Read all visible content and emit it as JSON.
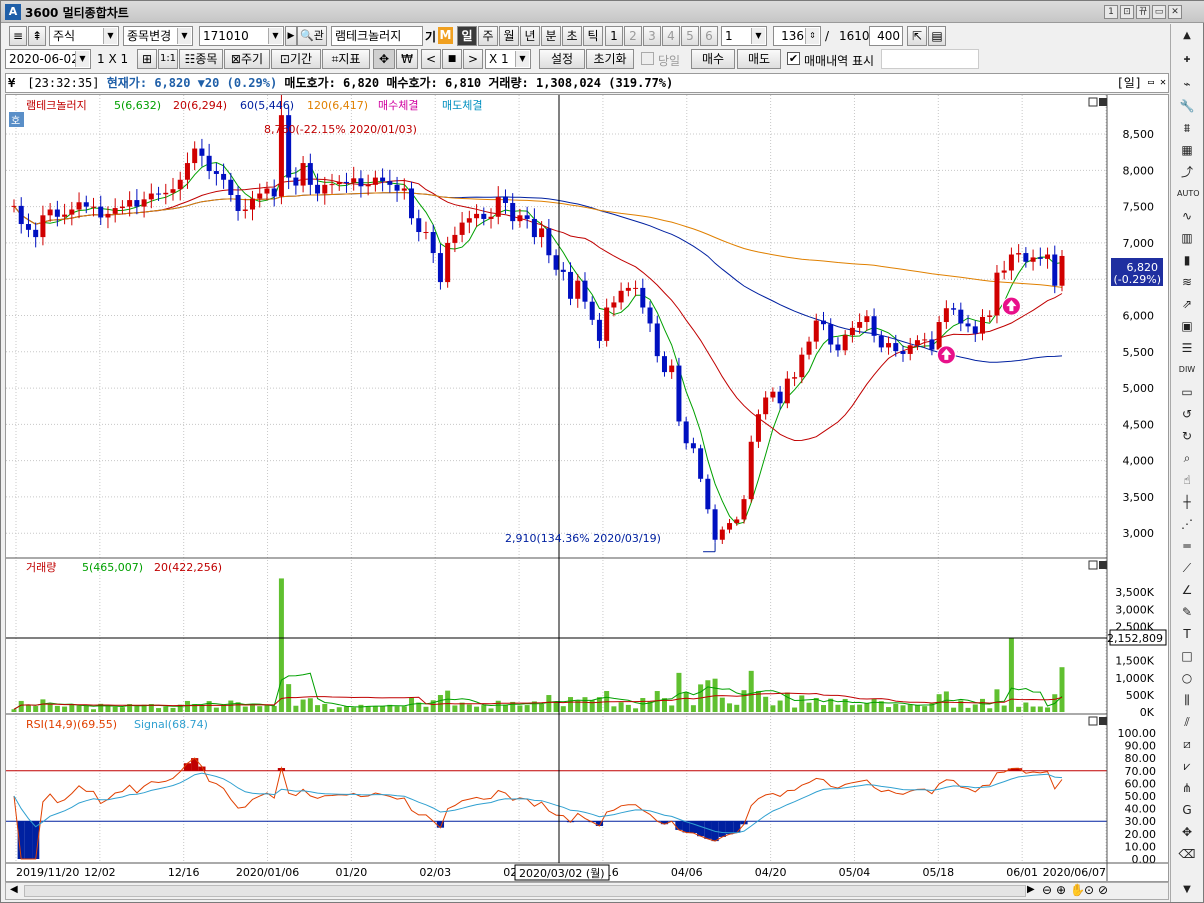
{
  "window": {
    "title": "3600 멀티종합차트",
    "controls": [
      "1",
      "⊡",
      "뀨",
      "▭",
      "✕"
    ]
  },
  "toolbar1": {
    "type": "주식",
    "stock_action": "종목변경",
    "code": "171010",
    "search_icon_label": "관",
    "name": "램테크놀러지",
    "marks": [
      "기",
      "M"
    ],
    "periods": [
      "일",
      "주",
      "월",
      "년",
      "분",
      "초",
      "틱"
    ],
    "numbers": [
      "1",
      "2",
      "3",
      "4",
      "5",
      "6"
    ],
    "interval": "1",
    "count": "136",
    "slash": "/",
    "total": "1610",
    "view": "400"
  },
  "toolbar2": {
    "date": "2020-06-02",
    "layout": "1 X 1",
    "stock_btn": "종목",
    "cycle_btn": "주기",
    "period_btn": "기간",
    "indicator_btn": "지표",
    "won_label": "₩",
    "multiplier": "X 1",
    "settings": "설정",
    "reset": "초기화",
    "today_label": "당일",
    "buy": "매수",
    "sell": "매도",
    "trade_history_label": "매매내역 표시"
  },
  "info": {
    "time": "[23:32:35]",
    "price_label": "현재가:",
    "price": "6,820",
    "change": "▼20",
    "change_pct": "(0.29%)",
    "ask_label": "매도호가:",
    "ask": "6,820",
    "bid_label": "매수호가:",
    "bid": "6,810",
    "vol_label": "거래량:",
    "vol": "1,308,024",
    "vol_pct": "(319.77%)",
    "right_tag": "[일]"
  },
  "price_panel": {
    "corner": "호",
    "legend": [
      {
        "text": "램테크놀러지",
        "color": "#c00000"
      },
      {
        "text": "5(6,632)",
        "color": "#00a000"
      },
      {
        "text": "20(6,294)",
        "color": "#c00000"
      },
      {
        "text": "60(5,446)",
        "color": "#0020a0"
      },
      {
        "text": "120(6,417)",
        "color": "#e08000"
      },
      {
        "text": "매수체결",
        "color": "#d000a0"
      },
      {
        "text": "매도체결",
        "color": "#0090c0"
      }
    ],
    "high_label": "8,760(-22.15% 2020/01/03)",
    "low_label": "2,910(134.36% 2020/03/19)",
    "last_price": "6,820",
    "last_change": "(-0.29%)",
    "yticks": [
      "8,500",
      "8,000",
      "7,500",
      "7,000",
      "6,500",
      "6,000",
      "5,500",
      "5,000",
      "4,500",
      "4,000",
      "3,500",
      "3,000"
    ]
  },
  "volume_panel": {
    "legend": [
      {
        "text": "거래량",
        "color": "#c00000"
      },
      {
        "text": "5(465,007)",
        "color": "#00a000"
      },
      {
        "text": "20(422,256)",
        "color": "#c00000"
      }
    ],
    "yticks": [
      "3,500K",
      "3,000K",
      "2,500K",
      "1,500K",
      "1,000K",
      "500K",
      "0K"
    ],
    "cursor_value": "2,152,809"
  },
  "rsi_panel": {
    "legend": [
      {
        "text": "RSI(14,9)(69.55)",
        "color": "#e04000"
      },
      {
        "text": "Signal(68.74)",
        "color": "#30a0d0"
      }
    ],
    "yticks": [
      "100.00",
      "90.00",
      "80.00",
      "70.00",
      "60.00",
      "50.00",
      "40.00",
      "30.00",
      "20.00",
      "10.00",
      "0.00"
    ]
  },
  "xaxis": {
    "labels": [
      "2019/11/20",
      "12/02",
      "12/16",
      "2020/01/06",
      "01/20",
      "02/03",
      "02/17",
      "03/16",
      "04/06",
      "04/20",
      "05/04",
      "05/18",
      "06/01",
      "2020/06/07"
    ],
    "cursor_label": "2020/03/02 (월)"
  },
  "chart_data": {
    "type": "candlestick",
    "closes": [
      7510,
      7260,
      7180,
      7080,
      7380,
      7460,
      7360,
      7390,
      7460,
      7560,
      7500,
      7500,
      7350,
      7400,
      7480,
      7500,
      7590,
      7500,
      7600,
      7680,
      7670,
      7690,
      7740,
      7870,
      8100,
      8300,
      8200,
      7990,
      7950,
      7870,
      7660,
      7440,
      7460,
      7610,
      7680,
      7750,
      7640,
      8760,
      7900,
      7790,
      8100,
      7800,
      7680,
      7800,
      7810,
      7840,
      7830,
      7890,
      7780,
      7800,
      7900,
      7850,
      7800,
      7720,
      7750,
      7340,
      7150,
      7150,
      6860,
      6460,
      7000,
      7110,
      7280,
      7340,
      7400,
      7330,
      7360,
      7630,
      7550,
      7300,
      7380,
      7330,
      7080,
      7200,
      6830,
      6630,
      6600,
      6230,
      6480,
      6190,
      5940,
      5650,
      6110,
      6180,
      6340,
      6380,
      6380,
      6110,
      5890,
      5440,
      5220,
      5310,
      4540,
      4240,
      4170,
      3750,
      3330,
      2910,
      3050,
      3140,
      3190,
      3470,
      4260,
      4640,
      4870,
      4950,
      4790,
      5130,
      5150,
      5460,
      5640,
      5930,
      5880,
      5600,
      5520,
      5730,
      5830,
      5910,
      5990,
      5720,
      5560,
      5620,
      5510,
      5470,
      5590,
      5660,
      5670,
      5530,
      5910,
      6100,
      6080,
      5890,
      5850,
      5750,
      5980,
      6000,
      6590,
      6620,
      6840,
      6860,
      6740,
      6800,
      6780,
      6840,
      6410,
      6820
    ],
    "yrange": [
      2700,
      8900
    ],
    "ma": [
      "5",
      "20",
      "60",
      "120"
    ],
    "rsi_levels": [
      70,
      30
    ]
  }
}
